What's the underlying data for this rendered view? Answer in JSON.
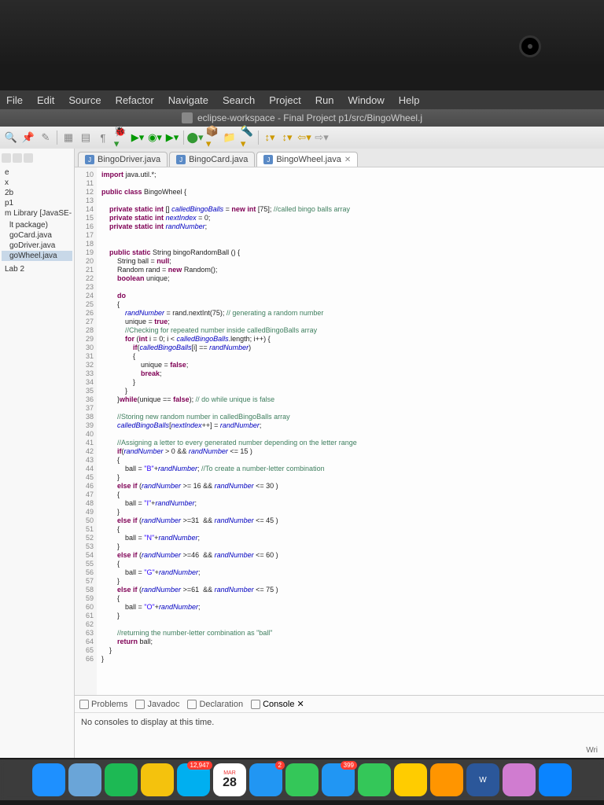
{
  "menubar": [
    "File",
    "Edit",
    "Source",
    "Refactor",
    "Navigate",
    "Search",
    "Project",
    "Run",
    "Window",
    "Help"
  ],
  "window_title": "eclipse-workspace - Final Project p1/src/BingoWheel.j",
  "sidebar": {
    "tree": [
      {
        "label": "e",
        "indent": 0
      },
      {
        "label": "x",
        "indent": 0
      },
      {
        "label": "2b",
        "indent": 0
      },
      {
        "label": "p1",
        "indent": 0
      },
      {
        "label": "m Library [JavaSE-",
        "indent": 0
      },
      {
        "label": "",
        "indent": 0
      },
      {
        "label": "lt package)",
        "indent": 1
      },
      {
        "label": "goCard.java",
        "indent": 1
      },
      {
        "label": "goDriver.java",
        "indent": 1
      },
      {
        "label": "goWheel.java",
        "indent": 1,
        "selected": true
      },
      {
        "label": "",
        "indent": 0
      },
      {
        "label": "",
        "indent": 0
      },
      {
        "label": "Lab 2",
        "indent": 0
      }
    ]
  },
  "editor_tabs": [
    {
      "label": "BingoDriver.java",
      "active": false
    },
    {
      "label": "BingoCard.java",
      "active": false
    },
    {
      "label": "BingoWheel.java",
      "active": true
    }
  ],
  "line_start": 10,
  "line_end": 66,
  "code_lines": [
    {
      "n": 10,
      "t": "import",
      "r": " java.util.*;",
      "class": "kw"
    },
    {
      "n": 11,
      "t": "",
      "r": ""
    },
    {
      "n": 12,
      "t": "public class",
      "r": " BingoWheel {",
      "class": "kw"
    },
    {
      "n": 13,
      "t": "",
      "r": ""
    },
    {
      "n": 14,
      "raw": "    <span class='kw'>private static int</span> [] <span class='fld'>calledBingoBalls</span> = <span class='kw'>new int</span> [75]; <span class='com'>//called bingo balls array</span>"
    },
    {
      "n": 15,
      "raw": "    <span class='kw'>private static int</span> <span class='fld'>nextIndex</span> = 0;"
    },
    {
      "n": 16,
      "raw": "    <span class='kw'>private static int</span> <span class='fld'>randNumber</span>;"
    },
    {
      "n": 17,
      "t": "",
      "r": ""
    },
    {
      "n": 18,
      "t": "",
      "r": ""
    },
    {
      "n": 19,
      "raw": "    <span class='kw'>public static</span> String bingoRandomBall () {"
    },
    {
      "n": 20,
      "raw": "        String ball = <span class='kw'>null</span>;"
    },
    {
      "n": 21,
      "raw": "        Random rand = <span class='kw'>new</span> Random();"
    },
    {
      "n": 22,
      "raw": "        <span class='kw'>boolean</span> unique;"
    },
    {
      "n": 23,
      "t": "",
      "r": ""
    },
    {
      "n": 24,
      "raw": "        <span class='kw'>do</span>"
    },
    {
      "n": 25,
      "raw": "        {"
    },
    {
      "n": 26,
      "raw": "            <span class='fld'>randNumber</span> = rand.nextInt(75); <span class='com'>// generating a random number</span>"
    },
    {
      "n": 27,
      "raw": "            unique = <span class='kw'>true</span>;"
    },
    {
      "n": 28,
      "raw": "            <span class='com'>//Checking for repeated number inside calledBingoBalls array</span>"
    },
    {
      "n": 29,
      "raw": "            <span class='kw'>for</span> (<span class='kw'>int</span> i = 0; i &lt; <span class='fld'>calledBingoBalls</span>.length; i++) {"
    },
    {
      "n": 30,
      "raw": "                <span class='kw'>if</span>(<span class='fld'>calledBingoBalls</span>[i] == <span class='fld'>randNumber</span>)"
    },
    {
      "n": 31,
      "raw": "                {"
    },
    {
      "n": 32,
      "raw": "                    unique = <span class='kw'>false</span>;"
    },
    {
      "n": 33,
      "raw": "                    <span class='kw'>break</span>;"
    },
    {
      "n": 34,
      "raw": "                }"
    },
    {
      "n": 35,
      "raw": "            }"
    },
    {
      "n": 36,
      "raw": "        }<span class='kw'>while</span>(unique == <span class='kw'>false</span>); <span class='com'>// do while unique is false</span>"
    },
    {
      "n": 37,
      "t": "",
      "r": ""
    },
    {
      "n": 38,
      "raw": "        <span class='com'>//Storing new random number in calledBingoBalls array</span>"
    },
    {
      "n": 39,
      "raw": "        <span class='fld'>calledBingoBalls</span>[<span class='fld'>nextIndex</span>++] = <span class='fld'>randNumber</span>;"
    },
    {
      "n": 40,
      "t": "",
      "r": ""
    },
    {
      "n": 41,
      "raw": "        <span class='com'>//Assigning a letter to every generated number depending on the letter range</span>"
    },
    {
      "n": 42,
      "raw": "        <span class='kw'>if</span>(<span class='fld'>randNumber</span> &gt; 0 &amp;&amp; <span class='fld'>randNumber</span> &lt;= 15 )"
    },
    {
      "n": 43,
      "raw": "        {"
    },
    {
      "n": 44,
      "raw": "            ball = <span class='str'>\"B\"</span>+<span class='fld'>randNumber</span>; <span class='com'>//To create a number-letter combination</span>"
    },
    {
      "n": 45,
      "raw": "        }"
    },
    {
      "n": 46,
      "raw": "        <span class='kw'>else if</span> (<span class='fld'>randNumber</span> &gt;= 16 &amp;&amp; <span class='fld'>randNumber</span> &lt;= 30 )"
    },
    {
      "n": 47,
      "raw": "        {"
    },
    {
      "n": 48,
      "raw": "            ball = <span class='str'>\"I\"</span>+<span class='fld'>randNumber</span>;"
    },
    {
      "n": 49,
      "raw": "        }"
    },
    {
      "n": 50,
      "raw": "        <span class='kw'>else if</span> (<span class='fld'>randNumber</span> &gt;=31  &amp;&amp; <span class='fld'>randNumber</span> &lt;= 45 )"
    },
    {
      "n": 51,
      "raw": "        {"
    },
    {
      "n": 52,
      "raw": "            ball = <span class='str'>\"N\"</span>+<span class='fld'>randNumber</span>;"
    },
    {
      "n": 53,
      "raw": "        }"
    },
    {
      "n": 54,
      "raw": "        <span class='kw'>else if</span> (<span class='fld'>randNumber</span> &gt;=46  &amp;&amp; <span class='fld'>randNumber</span> &lt;= 60 )"
    },
    {
      "n": 55,
      "raw": "        {"
    },
    {
      "n": 56,
      "raw": "            ball = <span class='str'>\"G\"</span>+<span class='fld'>randNumber</span>;"
    },
    {
      "n": 57,
      "raw": "        }"
    },
    {
      "n": 58,
      "raw": "        <span class='kw'>else if</span> (<span class='fld'>randNumber</span> &gt;=61  &amp;&amp; <span class='fld'>randNumber</span> &lt;= 75 )"
    },
    {
      "n": 59,
      "raw": "        {"
    },
    {
      "n": 60,
      "raw": "            ball = <span class='str'>\"O\"</span>+<span class='fld'>randNumber</span>;"
    },
    {
      "n": 61,
      "raw": "        }"
    },
    {
      "n": 62,
      "t": "",
      "r": ""
    },
    {
      "n": 63,
      "raw": "        <span class='com'>//returning the number-letter combination as \"ball\"</span>"
    },
    {
      "n": 64,
      "raw": "        <span class='kw'>return</span> ball;"
    },
    {
      "n": 65,
      "raw": "    }"
    },
    {
      "n": 66,
      "raw": "}"
    }
  ],
  "bottom_tabs": [
    {
      "label": "Problems",
      "active": false
    },
    {
      "label": "Javadoc",
      "active": false
    },
    {
      "label": "Declaration",
      "active": false
    },
    {
      "label": "Console",
      "active": true
    }
  ],
  "console_msg": "No consoles to display at this time.",
  "status_right": "Wri",
  "dock": {
    "calendar": {
      "month": "MAR",
      "day": "28"
    },
    "skype_badge": "12,947",
    "mail_badge": "2",
    "safari_badge": "399",
    "items": [
      {
        "name": "finder",
        "bg": "#1e90ff"
      },
      {
        "name": "safari-left",
        "bg": "#6aa5d8"
      },
      {
        "name": "spotify",
        "bg": "#1db954"
      },
      {
        "name": "chrome",
        "bg": "#f4c20d"
      },
      {
        "name": "skype",
        "bg": "#00aff0",
        "badge": "12,947"
      },
      {
        "name": "calendar",
        "cal": true
      },
      {
        "name": "mail",
        "bg": "#2196f3",
        "badge": "2"
      },
      {
        "name": "messages",
        "bg": "#34c759"
      },
      {
        "name": "safari",
        "bg": "#2196f3",
        "badge": "399"
      },
      {
        "name": "facetime",
        "bg": "#34c759"
      },
      {
        "name": "app1",
        "bg": "#ffcc00"
      },
      {
        "name": "firefox",
        "bg": "#ff9500"
      },
      {
        "name": "word",
        "bg": "#2b579a",
        "text": "W"
      },
      {
        "name": "itunes",
        "bg": "#d07cd0"
      },
      {
        "name": "appstore",
        "bg": "#0a84ff"
      }
    ]
  }
}
